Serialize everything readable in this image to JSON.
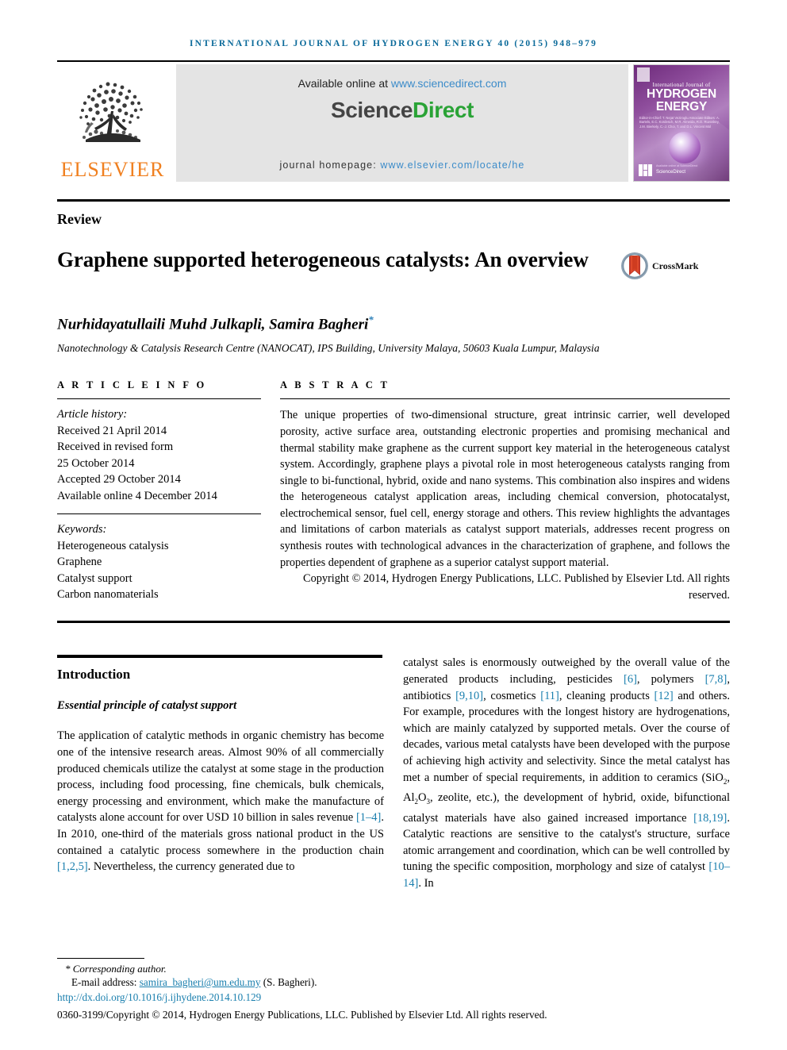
{
  "running_head": "INTERNATIONAL JOURNAL OF HYDROGEN ENERGY 40 (2015) 948–979",
  "masthead": {
    "publisher_wordmark": "ELSEVIER",
    "available_prefix": "Available online at ",
    "available_url": "www.sciencedirect.com",
    "sciencedirect_science": "Science",
    "sciencedirect_direct": "Direct",
    "homepage_label": "journal homepage: ",
    "homepage_url": "www.elsevier.com/locate/he",
    "cover": {
      "small_title": "International Journal of",
      "big_title_line1": "HYDROGEN",
      "big_title_line2": "ENERGY",
      "editors": "Editor-in-Chief:  T. Nejat Veziroglu\nAssociate Editors:  A. Bartels, E.C. Kordesch, M.R. Almeida, R.D. Ruvoskey, J.M. Bierkely, C.-J. Choi, T. and D.L. Vincent Mol",
      "sciencedirect_tiny": "Available online at ScienceDirect",
      "sciencedirect_label": "ScienceDirect"
    }
  },
  "article": {
    "type": "Review",
    "title": "Graphene supported heterogeneous catalysts: An overview",
    "crossmark_label": "CrossMark",
    "authors": "Nurhidayatullaili Muhd Julkapli, Samira Bagheri",
    "author_star": "*",
    "affiliation": "Nanotechnology & Catalysis Research Centre (NANOCAT), IPS Building, University Malaya, 50603 Kuala Lumpur, Malaysia"
  },
  "article_info": {
    "heading": "A R T I C L E   I N F O",
    "history_label": "Article history:",
    "history": [
      "Received 21 April 2014",
      "Received in revised form",
      "25 October 2014",
      "Accepted 29 October 2014",
      "Available online 4 December 2014"
    ],
    "keywords_label": "Keywords:",
    "keywords": [
      "Heterogeneous catalysis",
      "Graphene",
      "Catalyst support",
      "Carbon nanomaterials"
    ]
  },
  "abstract": {
    "heading": "A B S T R A C T",
    "body": "The unique properties of two-dimensional structure, great intrinsic carrier, well developed porosity, active surface area, outstanding electronic properties and promising mechanical and thermal stability make graphene as the current support key material in the heterogeneous catalyst system. Accordingly, graphene plays a pivotal role in most heterogeneous catalysts ranging from single to bi-functional, hybrid, oxide and nano systems. This combination also inspires and widens the heterogeneous catalyst application areas, including chemical conversion, photocatalyst, electrochemical sensor, fuel cell, energy storage and others. This review highlights the advantages and limitations of carbon materials as catalyst support materials, addresses recent progress on synthesis routes with technological advances in the characterization of graphene, and follows the properties dependent of graphene as a superior catalyst support material.",
    "copyright": "Copyright © 2014, Hydrogen Energy Publications, LLC. Published by Elsevier Ltd. All rights reserved."
  },
  "body": {
    "heading": "Introduction",
    "subheading": "Essential principle of catalyst support",
    "left_paragraph_1": "The application of catalytic methods in organic chemistry has become one of the intensive research areas. Almost 90% of all commercially produced chemicals utilize the catalyst at some stage in the production process, including food processing, fine chemicals, bulk chemicals, energy processing and environment, which make the manufacture of catalysts alone account for over USD 10 billion in sales revenue ",
    "left_cite_1": "[1–4]",
    "left_paragraph_2": ". In 2010, one-third of the materials gross national product in the US contained a catalytic process somewhere in the production chain ",
    "left_cite_2": "[1,2,5]",
    "left_paragraph_3": ". Nevertheless, the currency generated due to",
    "right_paragraph_1": "catalyst sales is enormously outweighed by the overall value of the generated products including, pesticides ",
    "right_cite_1": "[6]",
    "right_paragraph_2": ", polymers ",
    "right_cite_2": "[7,8]",
    "right_paragraph_3": ", antibiotics ",
    "right_cite_3": "[9,10]",
    "right_paragraph_4": ", cosmetics ",
    "right_cite_4": "[11]",
    "right_paragraph_5": ", cleaning products ",
    "right_cite_5": "[12]",
    "right_paragraph_6": " and others. For example, procedures with the longest history are hydrogenations, which are mainly catalyzed by supported metals. Over the course of decades, various metal catalysts have been developed with the purpose of achieving high activity and selectivity. Since the metal catalyst has met a number of special requirements, in addition to ceramics (SiO",
    "right_sub_1": "2",
    "right_paragraph_7": ", Al",
    "right_sub_2": "2",
    "right_paragraph_8": "O",
    "right_sub_3": "3",
    "right_paragraph_9": ", zeolite, etc.), the development of hybrid, oxide, bifunctional catalyst materials have also gained increased importance ",
    "right_cite_6": "[18,19]",
    "right_paragraph_10": ". Catalytic reactions are sensitive to the catalyst's structure, surface atomic arrangement and coordination, which can be well controlled by tuning the specific composition, morphology and size of catalyst ",
    "right_cite_7": "[10–14]",
    "right_paragraph_11": ". In"
  },
  "footnotes": {
    "corresponding": "* Corresponding author.",
    "email_label": "E-mail address: ",
    "email": "samira_bagheri@um.edu.my",
    "email_suffix": " (S. Bagheri).",
    "doi": "http://dx.doi.org/10.1016/j.ijhydene.2014.10.129",
    "issn_line": "0360-3199/Copyright © 2014, Hydrogen Energy Publications, LLC. Published by Elsevier Ltd. All rights reserved."
  },
  "colors": {
    "link": "#1a7fae",
    "running_head": "#0b6a9a",
    "elsevier_orange": "#f08020",
    "sciencedirect_green": "#2aa336"
  }
}
